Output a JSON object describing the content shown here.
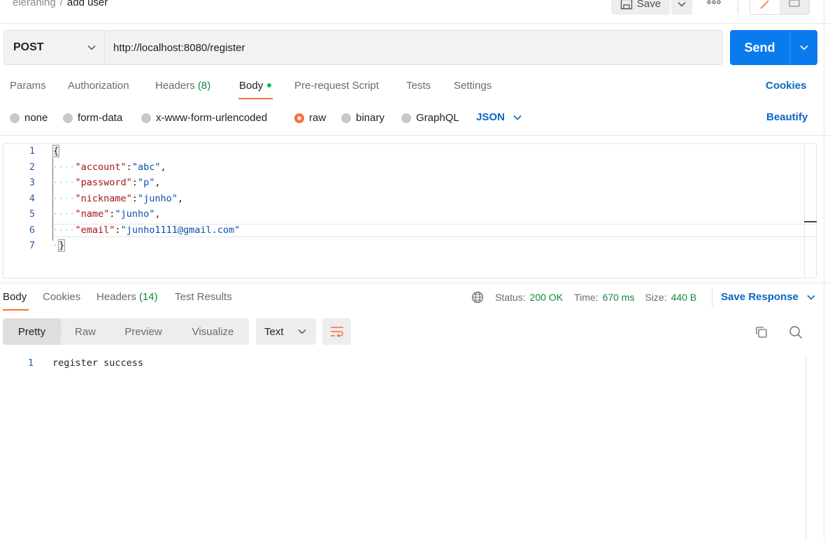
{
  "breadcrumb": {
    "workspace": "eleraning",
    "separator": "/",
    "current": "add user"
  },
  "toolbar": {
    "save_label": "Save"
  },
  "request": {
    "method": "POST",
    "url": "http://localhost:8080/register",
    "send_label": "Send"
  },
  "request_tabs": {
    "params": "Params",
    "authorization": "Authorization",
    "headers": "Headers",
    "headers_count": "(8)",
    "body": "Body",
    "prerequest": "Pre-request Script",
    "tests": "Tests",
    "settings": "Settings",
    "cookies": "Cookies"
  },
  "body_types": {
    "none": "none",
    "form_data": "form-data",
    "urlencoded": "x-www-form-urlencoded",
    "raw": "raw",
    "binary": "binary",
    "graphql": "GraphQL",
    "selected": "raw",
    "format": "JSON",
    "beautify": "Beautify"
  },
  "editor": {
    "line_numbers": [
      "1",
      "2",
      "3",
      "4",
      "5",
      "6",
      "7"
    ],
    "open_brace": "{",
    "close_brace": "}",
    "fields": [
      {
        "key": "\"account\"",
        "value": "\"abc\"",
        "trail": ","
      },
      {
        "key": "\"password\"",
        "value": "\"p\"",
        "trail": ","
      },
      {
        "key": "\"nickname\"",
        "value": "\"junho\"",
        "trail": ","
      },
      {
        "key": "\"name\"",
        "value": "\"junho\"",
        "trail": ","
      },
      {
        "key": "\"email\"",
        "value": "\"junho1111@gmail.com\"",
        "trail": ""
      }
    ],
    "indent": "····",
    "colon": ":"
  },
  "response_tabs": {
    "body": "Body",
    "cookies": "Cookies",
    "headers": "Headers",
    "headers_count": "(14)",
    "test_results": "Test Results"
  },
  "response_status": {
    "status_label": "Status:",
    "status_value": "200 OK",
    "time_label": "Time:",
    "time_value": "670 ms",
    "size_label": "Size:",
    "size_value": "440 B",
    "save_response": "Save Response"
  },
  "response_view": {
    "pretty": "Pretty",
    "raw": "Raw",
    "preview": "Preview",
    "visualize": "Visualize",
    "format": "Text",
    "line_number": "1",
    "content": "register success"
  },
  "colors": {
    "accent": "#ff6c37",
    "primary": "#097bed",
    "link": "#0b66c3",
    "success": "#0f8a3c"
  }
}
